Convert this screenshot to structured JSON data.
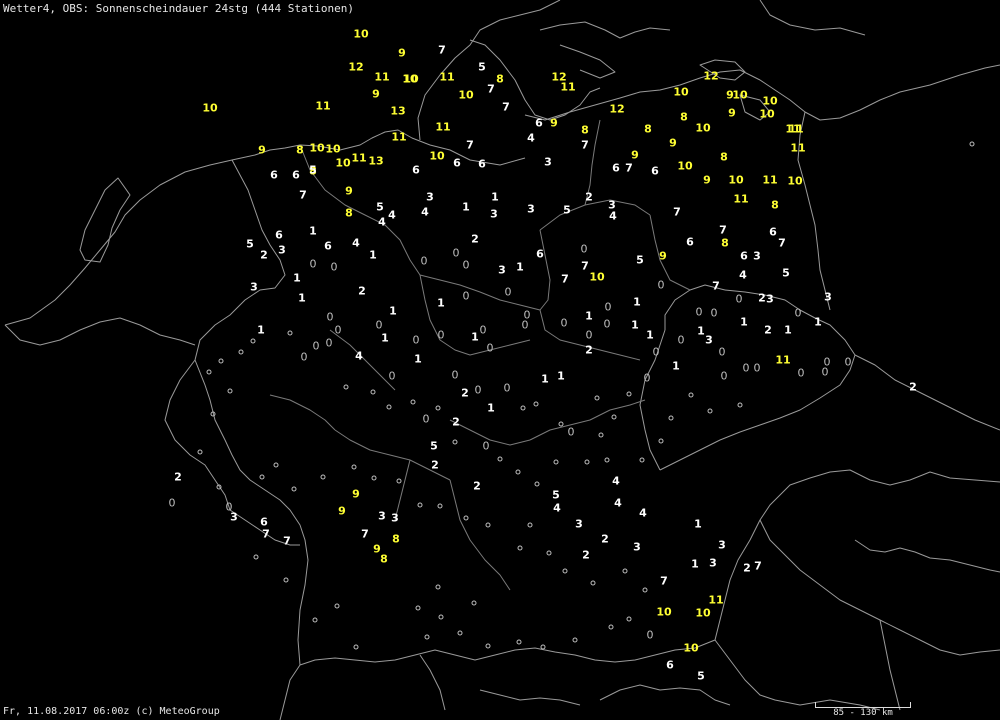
{
  "title": "Wetter4, OBS: Sonnenscheindauer 24stg (444 Stationen)",
  "footer": "Fr, 11.08.2017 06:00z (c) MeteoGroup",
  "scale_label": "85 - 130 km",
  "colors": {
    "high": "#ffff33",
    "mid": "#ffffff",
    "zero": "#bdbdbd",
    "border": "#9a9a9a",
    "background": "#000000"
  },
  "station_values": [
    "10",
    "9",
    "7",
    "12",
    "11",
    "10",
    "11",
    "5",
    "8",
    "7",
    "9",
    "10",
    "7",
    "11",
    "12",
    "11",
    "8",
    "11",
    "13",
    "11",
    "10",
    "9",
    "11",
    "10",
    "10",
    "13",
    "10",
    "10",
    "12",
    "12",
    "10",
    "9",
    "10",
    "11",
    "7",
    "6",
    "9",
    "4",
    "8",
    "7",
    "8",
    "10",
    "9",
    "8",
    "9",
    "10",
    "6",
    "7",
    "11",
    "9",
    "10",
    "8",
    "10",
    "11",
    "10",
    "9",
    "10",
    "11",
    "6",
    "6",
    "8",
    "8",
    "10",
    "11",
    "6",
    "6",
    "5",
    "4",
    "3",
    "7",
    "6",
    "6",
    "9",
    "8",
    "5",
    "4",
    "4",
    "3",
    "2",
    "1",
    "1",
    "3",
    "3",
    "5",
    "3",
    "7",
    "6",
    "8",
    "6",
    "4",
    "6",
    "6",
    "5",
    "4",
    "2",
    "3",
    "1",
    "0",
    "0",
    "1",
    "2",
    "1",
    "3",
    "2",
    "0",
    "0",
    "0",
    "3",
    "1",
    "0",
    "6",
    "5",
    "9",
    "7",
    "10",
    "7",
    "7",
    "6",
    "7",
    "7",
    "3",
    "4",
    "5",
    "2",
    "3",
    "3",
    "3",
    "1",
    "2",
    "1",
    "0",
    "1",
    "0",
    "0",
    "0",
    "1",
    "0",
    "1",
    "1",
    "1",
    "0",
    "0",
    "0",
    "0",
    "1",
    "0",
    "0",
    "1",
    "1",
    "0",
    "0",
    "0",
    "0",
    "1",
    "1",
    "0",
    "0",
    "0",
    "4",
    "0",
    "1",
    "1",
    "0",
    "0",
    "0",
    "0",
    "1",
    "0",
    "0",
    "0",
    "1",
    "0",
    "0",
    "0",
    "11",
    "0",
    "0",
    "0",
    "0",
    "2",
    "0",
    "0",
    "0",
    "2",
    "0",
    "1",
    "2",
    "1",
    "1",
    "0",
    "0",
    "2",
    "0",
    "0",
    "5",
    "2",
    "2",
    "0",
    "0",
    "6",
    "7",
    "3",
    "7",
    "9",
    "9",
    "3",
    "3",
    "2",
    "5",
    "4",
    "4",
    "4",
    "4",
    "3",
    "2",
    "3",
    "2",
    "1",
    "1",
    "3",
    "3",
    "2",
    "7",
    "7",
    "11",
    "10",
    "10",
    "0",
    "10",
    "5",
    "6",
    "7",
    "8",
    "9",
    "8"
  ]
}
